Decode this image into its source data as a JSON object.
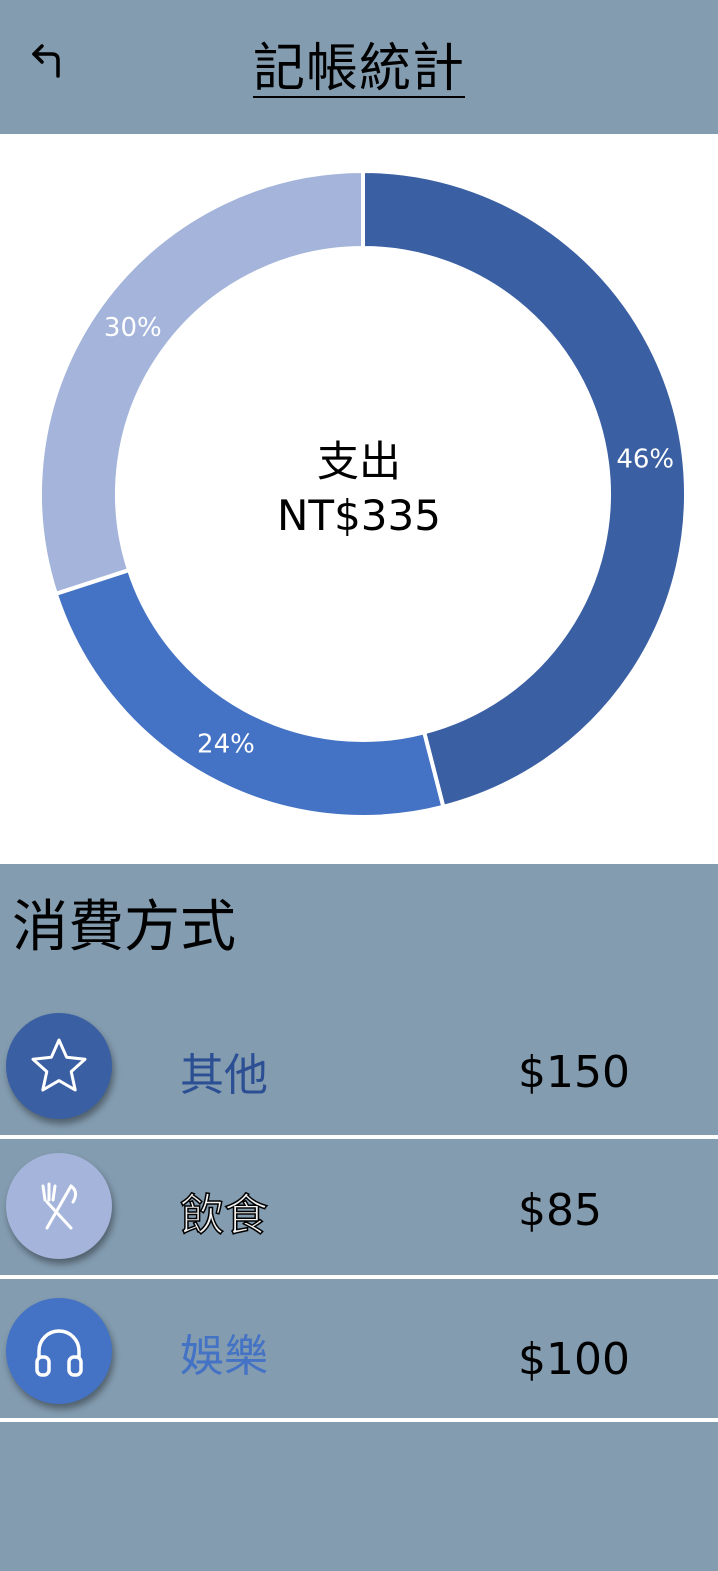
{
  "header": {
    "title": "記帳統計",
    "back_icon": "back-arrow-icon"
  },
  "summary": {
    "label": "支出",
    "total": "NT$335"
  },
  "chart_data": {
    "type": "pie",
    "categories": [
      "其他",
      "娛樂",
      "飲食"
    ],
    "values": [
      46,
      24,
      30
    ],
    "labels": [
      "46%",
      "24%",
      "30%"
    ],
    "colors": [
      "#3a5fa3",
      "#4472c4",
      "#a4b4da"
    ]
  },
  "section": {
    "title": "消費方式"
  },
  "categories": [
    {
      "name": "其他",
      "amount": "$150",
      "icon": "star-icon",
      "color": "#3a5fa3",
      "label_color": "#2c4f93"
    },
    {
      "name": "飲食",
      "amount": "$85",
      "icon": "utensils-icon",
      "color": "#a4b4da",
      "label_color": "#f2f2f2"
    },
    {
      "name": "娛樂",
      "amount": "$100",
      "icon": "headphones-icon",
      "color": "#4472c4",
      "label_color": "#4472c4"
    }
  ]
}
